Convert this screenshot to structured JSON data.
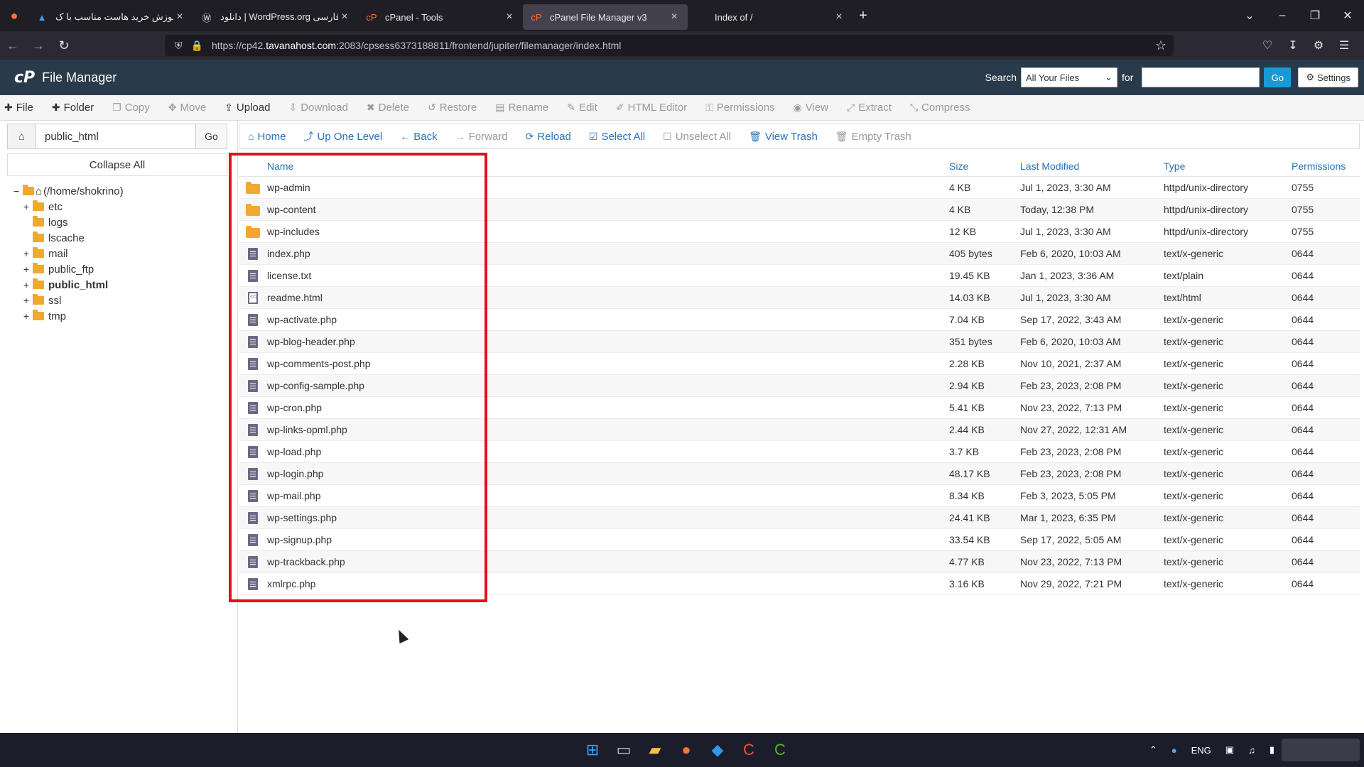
{
  "browser": {
    "tabs": [
      {
        "title": "آموزش خرید هاست مناسب با ک",
        "icon": "graduation-cap-icon",
        "active": false
      },
      {
        "title": "دانلود | WordPress.org فارسی",
        "icon": "wordpress-icon",
        "active": false
      },
      {
        "title": "cPanel - Tools",
        "icon": "cpanel-icon",
        "active": false
      },
      {
        "title": "cPanel File Manager v3",
        "icon": "cpanel-icon",
        "active": true
      },
      {
        "title": "Index of /",
        "icon": "",
        "active": false
      }
    ],
    "url_prefix": "https://cp42.",
    "url_host": "tavanahost.com",
    "url_rest": ":2083/cpsess6373188811/frontend/jupiter/filemanager/index.html"
  },
  "header": {
    "logo": "cP",
    "title": "File Manager",
    "search_label": "Search",
    "search_scope": "All Your Files",
    "for_label": "for",
    "search_value": "",
    "go_label": "Go",
    "settings_label": "Settings"
  },
  "toolbar": [
    {
      "label": "File",
      "icon": "plus-icon",
      "enabled": true
    },
    {
      "label": "Folder",
      "icon": "plus-icon",
      "enabled": true
    },
    {
      "label": "Copy",
      "icon": "copy-icon",
      "enabled": false
    },
    {
      "label": "Move",
      "icon": "move-icon",
      "enabled": false
    },
    {
      "label": "Upload",
      "icon": "upload-icon",
      "enabled": true
    },
    {
      "label": "Download",
      "icon": "download-icon",
      "enabled": false
    },
    {
      "label": "Delete",
      "icon": "delete-icon",
      "enabled": false
    },
    {
      "label": "Restore",
      "icon": "restore-icon",
      "enabled": false
    },
    {
      "label": "Rename",
      "icon": "rename-icon",
      "enabled": false
    },
    {
      "label": "Edit",
      "icon": "pencil-icon",
      "enabled": false
    },
    {
      "label": "HTML Editor",
      "icon": "html-editor-icon",
      "enabled": false
    },
    {
      "label": "Permissions",
      "icon": "key-icon",
      "enabled": false
    },
    {
      "label": "View",
      "icon": "eye-icon",
      "enabled": false
    },
    {
      "label": "Extract",
      "icon": "extract-icon",
      "enabled": false
    },
    {
      "label": "Compress",
      "icon": "compress-icon",
      "enabled": false
    }
  ],
  "left": {
    "path_value": "public_html",
    "go_label": "Go",
    "collapse_label": "Collapse All",
    "tree": [
      {
        "label": "(/home/shokrino)",
        "expander": "−",
        "kind": "home",
        "bold": false
      },
      {
        "label": "etc",
        "expander": "+",
        "kind": "folder",
        "bold": false
      },
      {
        "label": "logs",
        "expander": "",
        "kind": "folder",
        "bold": false
      },
      {
        "label": "lscache",
        "expander": "",
        "kind": "folder",
        "bold": false
      },
      {
        "label": "mail",
        "expander": "+",
        "kind": "folder",
        "bold": false
      },
      {
        "label": "public_ftp",
        "expander": "+",
        "kind": "folder",
        "bold": false
      },
      {
        "label": "public_html",
        "expander": "+",
        "kind": "folder",
        "bold": true
      },
      {
        "label": "ssl",
        "expander": "+",
        "kind": "folder",
        "bold": false
      },
      {
        "label": "tmp",
        "expander": "+",
        "kind": "folder",
        "bold": false
      }
    ]
  },
  "actions": [
    {
      "label": "Home",
      "icon": "home-icon",
      "enabled": true
    },
    {
      "label": "Up One Level",
      "icon": "level-up-icon",
      "enabled": true
    },
    {
      "label": "Back",
      "icon": "arrow-left-icon",
      "enabled": true
    },
    {
      "label": "Forward",
      "icon": "arrow-right-icon",
      "enabled": false
    },
    {
      "label": "Reload",
      "icon": "reload-icon",
      "enabled": true
    },
    {
      "label": "Select All",
      "icon": "checkbox-checked-icon",
      "enabled": true
    },
    {
      "label": "Unselect All",
      "icon": "checkbox-empty-icon",
      "enabled": false
    },
    {
      "label": "View Trash",
      "icon": "trash-icon",
      "enabled": true
    },
    {
      "label": "Empty Trash",
      "icon": "trash-icon",
      "enabled": false
    }
  ],
  "table": {
    "headers": {
      "name": "Name",
      "size": "Size",
      "modified": "Last Modified",
      "type": "Type",
      "perms": "Permissions"
    },
    "rows": [
      {
        "name": "wp-admin",
        "size": "4 KB",
        "modified": "Jul 1, 2023, 3:30 AM",
        "type": "httpd/unix-directory",
        "perms": "0755",
        "kind": "dir"
      },
      {
        "name": "wp-content",
        "size": "4 KB",
        "modified": "Today, 12:38 PM",
        "type": "httpd/unix-directory",
        "perms": "0755",
        "kind": "dir"
      },
      {
        "name": "wp-includes",
        "size": "12 KB",
        "modified": "Jul 1, 2023, 3:30 AM",
        "type": "httpd/unix-directory",
        "perms": "0755",
        "kind": "dir"
      },
      {
        "name": "index.php",
        "size": "405 bytes",
        "modified": "Feb 6, 2020, 10:03 AM",
        "type": "text/x-generic",
        "perms": "0644",
        "kind": "file"
      },
      {
        "name": "license.txt",
        "size": "19.45 KB",
        "modified": "Jan 1, 2023, 3:36 AM",
        "type": "text/plain",
        "perms": "0644",
        "kind": "file"
      },
      {
        "name": "readme.html",
        "size": "14.03 KB",
        "modified": "Jul 1, 2023, 3:30 AM",
        "type": "text/html",
        "perms": "0644",
        "kind": "html"
      },
      {
        "name": "wp-activate.php",
        "size": "7.04 KB",
        "modified": "Sep 17, 2022, 3:43 AM",
        "type": "text/x-generic",
        "perms": "0644",
        "kind": "file"
      },
      {
        "name": "wp-blog-header.php",
        "size": "351 bytes",
        "modified": "Feb 6, 2020, 10:03 AM",
        "type": "text/x-generic",
        "perms": "0644",
        "kind": "file"
      },
      {
        "name": "wp-comments-post.php",
        "size": "2.28 KB",
        "modified": "Nov 10, 2021, 2:37 AM",
        "type": "text/x-generic",
        "perms": "0644",
        "kind": "file"
      },
      {
        "name": "wp-config-sample.php",
        "size": "2.94 KB",
        "modified": "Feb 23, 2023, 2:08 PM",
        "type": "text/x-generic",
        "perms": "0644",
        "kind": "file"
      },
      {
        "name": "wp-cron.php",
        "size": "5.41 KB",
        "modified": "Nov 23, 2022, 7:13 PM",
        "type": "text/x-generic",
        "perms": "0644",
        "kind": "file"
      },
      {
        "name": "wp-links-opml.php",
        "size": "2.44 KB",
        "modified": "Nov 27, 2022, 12:31 AM",
        "type": "text/x-generic",
        "perms": "0644",
        "kind": "file"
      },
      {
        "name": "wp-load.php",
        "size": "3.7 KB",
        "modified": "Feb 23, 2023, 2:08 PM",
        "type": "text/x-generic",
        "perms": "0644",
        "kind": "file"
      },
      {
        "name": "wp-login.php",
        "size": "48.17 KB",
        "modified": "Feb 23, 2023, 2:08 PM",
        "type": "text/x-generic",
        "perms": "0644",
        "kind": "file"
      },
      {
        "name": "wp-mail.php",
        "size": "8.34 KB",
        "modified": "Feb 3, 2023, 5:05 PM",
        "type": "text/x-generic",
        "perms": "0644",
        "kind": "file"
      },
      {
        "name": "wp-settings.php",
        "size": "24.41 KB",
        "modified": "Mar 1, 2023, 6:35 PM",
        "type": "text/x-generic",
        "perms": "0644",
        "kind": "file"
      },
      {
        "name": "wp-signup.php",
        "size": "33.54 KB",
        "modified": "Sep 17, 2022, 5:05 AM",
        "type": "text/x-generic",
        "perms": "0644",
        "kind": "file"
      },
      {
        "name": "wp-trackback.php",
        "size": "4.77 KB",
        "modified": "Nov 23, 2022, 7:13 PM",
        "type": "text/x-generic",
        "perms": "0644",
        "kind": "file"
      },
      {
        "name": "xmlrpc.php",
        "size": "3.16 KB",
        "modified": "Nov 29, 2022, 7:21 PM",
        "type": "text/x-generic",
        "perms": "0644",
        "kind": "file"
      }
    ]
  },
  "taskbar": {
    "apps": [
      "windows-start-icon",
      "task-view-icon",
      "file-explorer-icon",
      "firefox-icon",
      "vscode-icon",
      "app-c-red-icon",
      "app-c-green-icon"
    ],
    "lang": "ENG"
  },
  "colors": {
    "accent": "#179bd7",
    "header_bg": "#293a4a",
    "link": "#2a72b5",
    "highlight_box": "#e0131a",
    "folder": "#f0a830"
  }
}
